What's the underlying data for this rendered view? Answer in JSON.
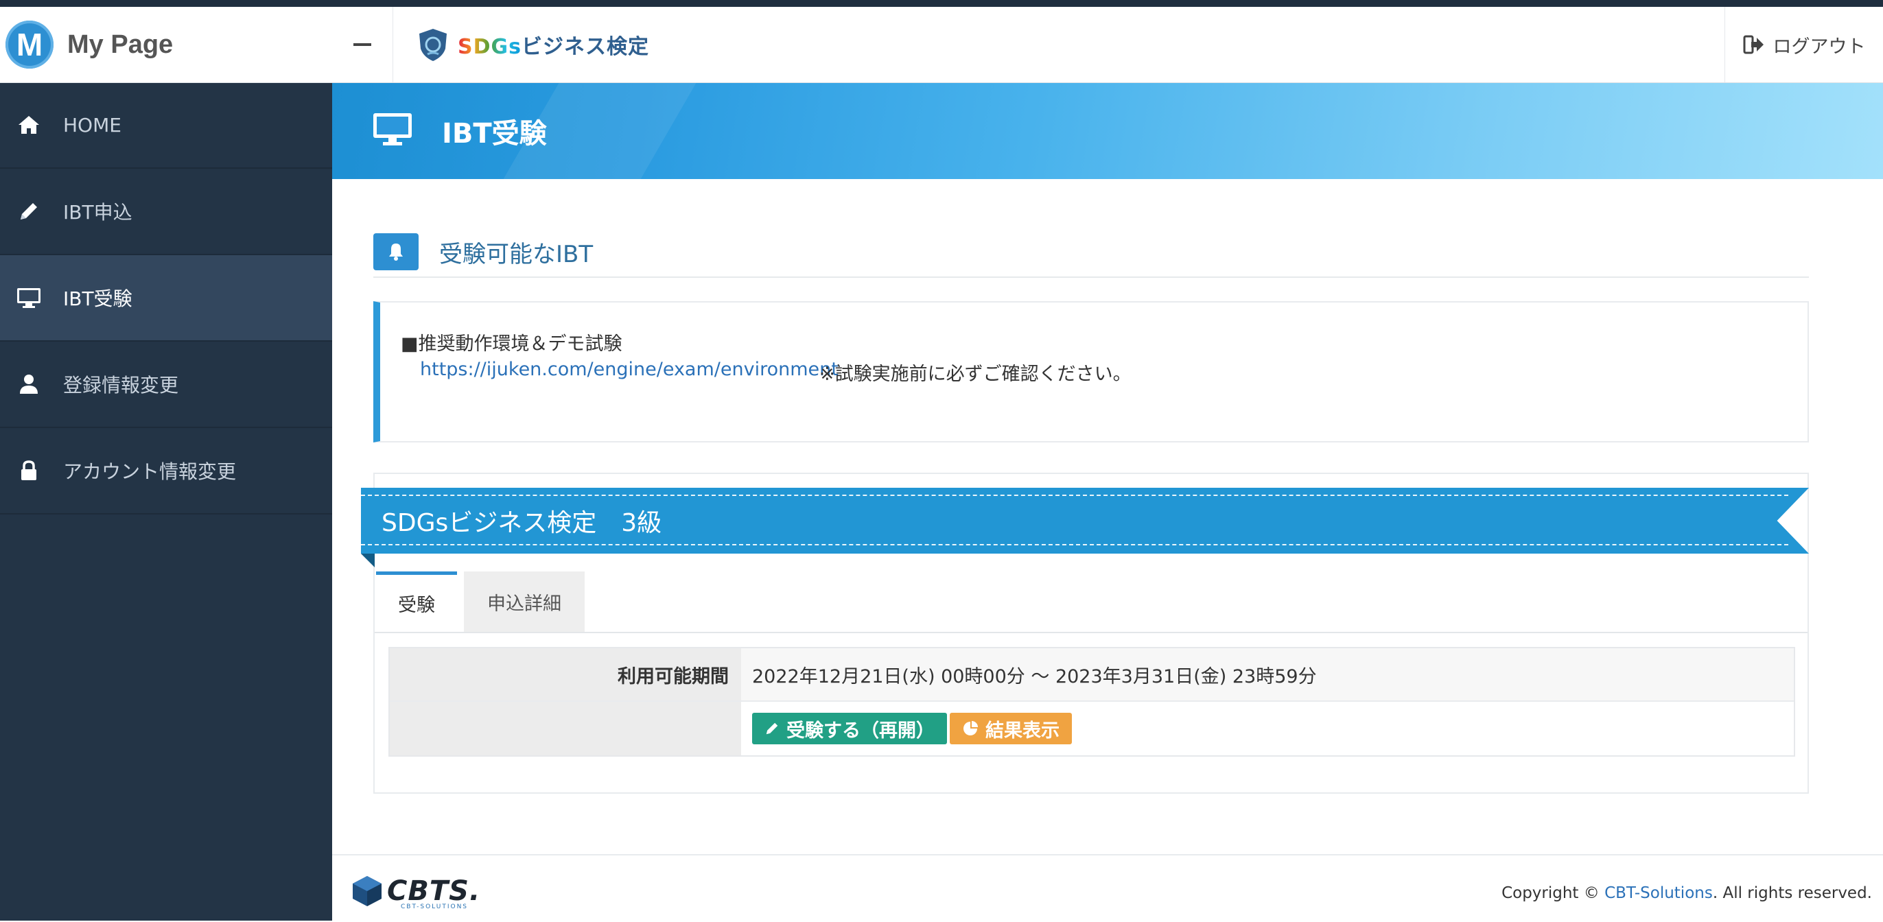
{
  "brand": {
    "logo_letter": "M",
    "title": "My Page"
  },
  "sidebar": {
    "items": [
      {
        "label": "HOME",
        "icon": "home-icon"
      },
      {
        "label": "IBT申込",
        "icon": "pencil-icon"
      },
      {
        "label": "IBT受験",
        "icon": "monitor-icon",
        "active": true
      },
      {
        "label": "登録情報変更",
        "icon": "user-icon"
      },
      {
        "label": "アカウント情報変更",
        "icon": "lock-icon"
      }
    ]
  },
  "header": {
    "logo_text_sdgs": "SDGs",
    "logo_text_rest": "ビジネス検定",
    "logout_label": "ログアウト"
  },
  "page": {
    "title": "IBT受験"
  },
  "section": {
    "title": "受験可能なIBT"
  },
  "notice": {
    "line1": "■推奨動作環境＆デモ試験",
    "link": "https://ijuken.com/engine/exam/environment",
    "note": "※試験実施前に必ずご確認ください。"
  },
  "exam": {
    "title": "SDGsビジネス検定　3級",
    "tabs": [
      "受験",
      "申込詳細"
    ],
    "period_label": "利用可能期間",
    "period_value": "2022年12月21日(水) 00時00分 ～ 2023年3月31日(金) 23時59分",
    "start_button": "受験する（再開）",
    "result_button": "結果表示"
  },
  "footer": {
    "logo_text": "CBTS.",
    "logo_sub": "CBT-SOLUTIONS",
    "copyright_prefix": "Copyright © ",
    "copyright_link": "CBT-Solutions",
    "copyright_suffix": ". All rights reserved."
  },
  "colors": {
    "sidebar_bg": "#233446",
    "accent": "#2d8fd2",
    "ribbon": "#2296d4",
    "button_green": "#21a085",
    "button_orange": "#f0a341"
  }
}
